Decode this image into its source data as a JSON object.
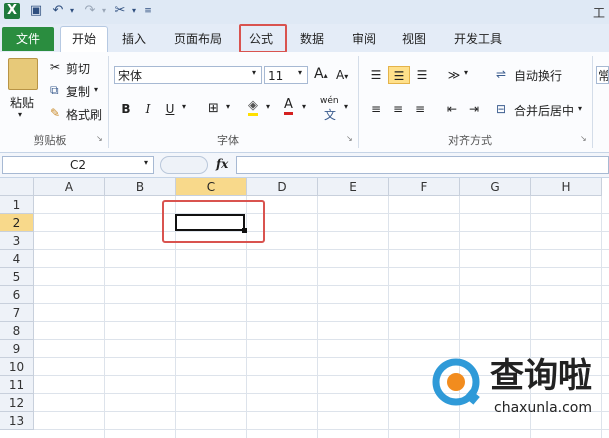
{
  "qat": {
    "app_title": "工"
  },
  "tabs": [
    {
      "label": "文件"
    },
    {
      "label": "开始"
    },
    {
      "label": "插入"
    },
    {
      "label": "页面布局"
    },
    {
      "label": "公式"
    },
    {
      "label": "数据"
    },
    {
      "label": "审阅"
    },
    {
      "label": "视图"
    },
    {
      "label": "开发工具"
    }
  ],
  "ribbon": {
    "clipboard": {
      "paste": "粘贴",
      "cut": "剪切",
      "copy": "复制",
      "format_painter": "格式刷",
      "label": "剪贴板"
    },
    "font": {
      "font_name": "宋体",
      "font_size": "11",
      "bold": "B",
      "italic": "I",
      "underline": "U",
      "label": "字体",
      "wen": "wén"
    },
    "alignment": {
      "wrap_text": "自动换行",
      "merge_center": "合并后居中",
      "label": "对齐方式"
    },
    "number": {
      "partial": "常"
    }
  },
  "formula_bar": {
    "name_box": "C2",
    "fx": "fx"
  },
  "grid": {
    "columns": [
      "A",
      "B",
      "C",
      "D",
      "E",
      "F",
      "G",
      "H"
    ],
    "rows": [
      "1",
      "2",
      "3",
      "4",
      "5",
      "6",
      "7",
      "8",
      "9",
      "10",
      "11",
      "12",
      "13"
    ],
    "selected_column": "C",
    "selected_row": "2"
  },
  "watermark": {
    "text": "查询啦",
    "url": "chaxunla.com"
  },
  "colors": {
    "file_tab": "#2a8d3f",
    "highlight": "#d9534f",
    "header_selected": "#f8d98b"
  }
}
